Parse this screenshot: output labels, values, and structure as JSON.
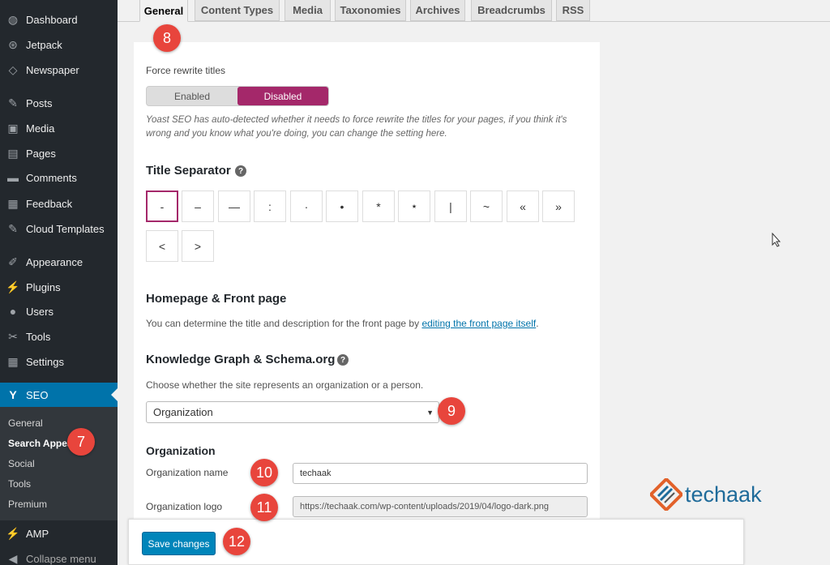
{
  "sidebar": {
    "items": [
      {
        "label": "Dashboard",
        "icon": "dashboard-icon",
        "glyph": "◍"
      },
      {
        "label": "Jetpack",
        "icon": "jetpack-icon",
        "glyph": "⊛"
      },
      {
        "label": "Newspaper",
        "icon": "newspaper-icon",
        "glyph": "◇"
      },
      {
        "label": "Posts",
        "icon": "pin-icon",
        "glyph": "✎"
      },
      {
        "label": "Media",
        "icon": "media-icon",
        "glyph": "▣"
      },
      {
        "label": "Pages",
        "icon": "pages-icon",
        "glyph": "▤"
      },
      {
        "label": "Comments",
        "icon": "comments-icon",
        "glyph": "▬"
      },
      {
        "label": "Feedback",
        "icon": "feedback-icon",
        "glyph": "▦"
      },
      {
        "label": "Cloud Templates",
        "icon": "pin-icon",
        "glyph": "✎"
      },
      {
        "label": "Appearance",
        "icon": "appearance-icon",
        "glyph": "✐"
      },
      {
        "label": "Plugins",
        "icon": "plugins-icon",
        "glyph": "⚡"
      },
      {
        "label": "Users",
        "icon": "users-icon",
        "glyph": "●"
      },
      {
        "label": "Tools",
        "icon": "tools-icon",
        "glyph": "✂"
      },
      {
        "label": "Settings",
        "icon": "settings-icon",
        "glyph": "▦"
      },
      {
        "label": "SEO",
        "icon": "yoast-icon",
        "glyph": "Y"
      }
    ],
    "submenu": [
      "General",
      "Search Appea",
      "Social",
      "Tools",
      "Premium"
    ],
    "amp": {
      "label": "AMP",
      "glyph": "⚡"
    },
    "collapse": {
      "label": "Collapse menu",
      "glyph": "◀"
    }
  },
  "tabs": [
    "General",
    "Content Types",
    "Media",
    "Taxonomies",
    "Archives",
    "Breadcrumbs",
    "RSS"
  ],
  "content": {
    "force_rewrite_label": "Force rewrite titles",
    "toggle": {
      "enabled": "Enabled",
      "disabled": "Disabled",
      "selected": "Disabled"
    },
    "force_rewrite_desc": "Yoast SEO has auto-detected whether it needs to force rewrite the titles for your pages, if you think it's wrong and you know what you're doing, you can change the setting here.",
    "title_separator_heading": "Title Separator",
    "help_glyph": "?",
    "separators": [
      "-",
      "–",
      "—",
      ":",
      "·",
      "•",
      "*",
      "⋆",
      "|",
      "~",
      "«",
      "»",
      "<",
      ">"
    ],
    "separator_selected": "-",
    "homepage_heading": "Homepage & Front page",
    "homepage_text": "You can determine the title and description for the front page by ",
    "homepage_link": "editing the front page itself",
    "homepage_period": ".",
    "kg_heading": "Knowledge Graph & Schema.org",
    "kg_text": "Choose whether the site represents an organization or a person.",
    "kg_select": "Organization",
    "org_heading": "Organization",
    "org_name_label": "Organization name",
    "org_name_value": "techaak",
    "org_logo_label": "Organization logo",
    "org_logo_value": "https://techaak.com/wp-content/uploads/2019/04/logo-dark.png"
  },
  "save_button": "Save changes",
  "badges": [
    "7",
    "8",
    "9",
    "10",
    "11",
    "12"
  ],
  "logo_text": "techaak",
  "colors": {
    "accent": "#a4286a",
    "wp_blue": "#0073aa",
    "badge_red": "#e8453c",
    "sidebar_bg": "#23282d"
  }
}
